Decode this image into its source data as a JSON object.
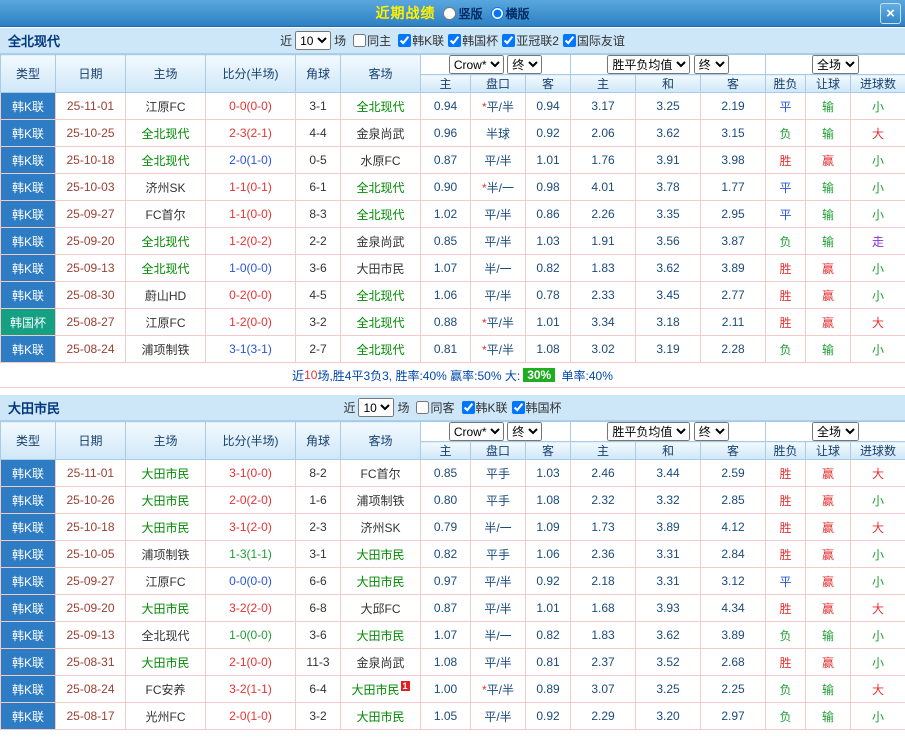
{
  "titlebar": {
    "title": "近期战绩",
    "layout_options": [
      {
        "label": "竖版",
        "checked": false
      },
      {
        "label": "横版",
        "checked": true
      }
    ],
    "close_label": "×"
  },
  "table_header": {
    "main": [
      "类型",
      "日期",
      "主场",
      "比分(半场)",
      "角球",
      "客场"
    ],
    "odds_source": "Crow*",
    "stage_label": "终",
    "avg_label": "胜平负均值",
    "scope_label": "全场",
    "sub": [
      "主",
      "盘口",
      "客",
      "主",
      "和",
      "客",
      "胜负",
      "让球",
      "进球数"
    ]
  },
  "colors": {
    "topbar_blue": "#2e80c4",
    "title_yellow": "#ffef00",
    "strip_blue": "#cde6f8",
    "league_blue": "#2d7cc4",
    "cup_teal": "#14a083",
    "focal_green": "#008a00",
    "date_red": "#9a4033",
    "odds_navy": "#1b4a7a",
    "win_red": "#e53333",
    "draw_blue": "#2b55d5",
    "loss_green": "#1f9e33",
    "push_purple": "#8833cc",
    "highlight_green": "#1fae1f",
    "data_border_pink": "#f2caca",
    "header_border_blue": "#a9cbe6"
  },
  "sections": [
    {
      "team": "全北现代",
      "filters": {
        "near": "近",
        "count": "10",
        "games": "场",
        "same": {
          "label": "同主",
          "checked": false
        },
        "leagues": [
          {
            "label": "韩K联",
            "checked": true
          },
          {
            "label": "韩国杯",
            "checked": true
          },
          {
            "label": "亚冠联2",
            "checked": true
          },
          {
            "label": "国际友谊",
            "checked": true
          }
        ]
      },
      "rows": [
        {
          "league": "韩K联",
          "cup": false,
          "date": "25-11-01",
          "home": "江原FC",
          "home_focal": false,
          "score": "0-0(0-0)",
          "score_color": "red",
          "corners": "3-1",
          "away": "全北现代",
          "away_focal": true,
          "odds_home": "0.94",
          "handicap": "*平/半",
          "odds_away": "0.94",
          "avg_home": "3.17",
          "avg_draw": "3.25",
          "avg_away": "2.19",
          "result": "平",
          "result_color": "blue",
          "handicap_result": "输",
          "handicap_result_color": "green",
          "goals_result": "小",
          "goals_result_color": "green"
        },
        {
          "league": "韩K联",
          "cup": false,
          "date": "25-10-25",
          "home": "全北现代",
          "home_focal": true,
          "score": "2-3(2-1)",
          "score_color": "red",
          "corners": "4-4",
          "away": "金泉尚武",
          "away_focal": false,
          "odds_home": "0.96",
          "handicap": "半球",
          "odds_away": "0.92",
          "avg_home": "2.06",
          "avg_draw": "3.62",
          "avg_away": "3.15",
          "result": "负",
          "result_color": "green",
          "handicap_result": "输",
          "handicap_result_color": "green",
          "goals_result": "大",
          "goals_result_color": "red"
        },
        {
          "league": "韩K联",
          "cup": false,
          "date": "25-10-18",
          "home": "全北现代",
          "home_focal": true,
          "score": "2-0(1-0)",
          "score_color": "blue",
          "corners": "0-5",
          "away": "水原FC",
          "away_focal": false,
          "odds_home": "0.87",
          "handicap": "平/半",
          "odds_away": "1.01",
          "avg_home": "1.76",
          "avg_draw": "3.91",
          "avg_away": "3.98",
          "result": "胜",
          "result_color": "red",
          "handicap_result": "赢",
          "handicap_result_color": "red",
          "goals_result": "小",
          "goals_result_color": "green"
        },
        {
          "league": "韩K联",
          "cup": false,
          "date": "25-10-03",
          "home": "济州SK",
          "home_focal": false,
          "score": "1-1(0-1)",
          "score_color": "red",
          "corners": "6-1",
          "away": "全北现代",
          "away_focal": true,
          "odds_home": "0.90",
          "handicap": "*半/一",
          "odds_away": "0.98",
          "avg_home": "4.01",
          "avg_draw": "3.78",
          "avg_away": "1.77",
          "result": "平",
          "result_color": "blue",
          "handicap_result": "输",
          "handicap_result_color": "green",
          "goals_result": "小",
          "goals_result_color": "green"
        },
        {
          "league": "韩K联",
          "cup": false,
          "date": "25-09-27",
          "home": "FC首尔",
          "home_focal": false,
          "score": "1-1(0-0)",
          "score_color": "red",
          "corners": "8-3",
          "away": "全北现代",
          "away_focal": true,
          "odds_home": "1.02",
          "handicap": "平/半",
          "odds_away": "0.86",
          "avg_home": "2.26",
          "avg_draw": "3.35",
          "avg_away": "2.95",
          "result": "平",
          "result_color": "blue",
          "handicap_result": "输",
          "handicap_result_color": "green",
          "goals_result": "小",
          "goals_result_color": "green"
        },
        {
          "league": "韩K联",
          "cup": false,
          "date": "25-09-20",
          "home": "全北现代",
          "home_focal": true,
          "score": "1-2(0-2)",
          "score_color": "red",
          "corners": "2-2",
          "away": "金泉尚武",
          "away_focal": false,
          "odds_home": "0.85",
          "handicap": "平/半",
          "odds_away": "1.03",
          "avg_home": "1.91",
          "avg_draw": "3.56",
          "avg_away": "3.87",
          "result": "负",
          "result_color": "green",
          "handicap_result": "输",
          "handicap_result_color": "green",
          "goals_result": "走",
          "goals_result_color": "purple"
        },
        {
          "league": "韩K联",
          "cup": false,
          "date": "25-09-13",
          "home": "全北现代",
          "home_focal": true,
          "score": "1-0(0-0)",
          "score_color": "blue",
          "corners": "3-6",
          "away": "大田市民",
          "away_focal": false,
          "odds_home": "1.07",
          "handicap": "半/一",
          "odds_away": "0.82",
          "avg_home": "1.83",
          "avg_draw": "3.62",
          "avg_away": "3.89",
          "result": "胜",
          "result_color": "red",
          "handicap_result": "赢",
          "handicap_result_color": "red",
          "goals_result": "小",
          "goals_result_color": "green"
        },
        {
          "league": "韩K联",
          "cup": false,
          "date": "25-08-30",
          "home": "蔚山HD",
          "home_focal": false,
          "score": "0-2(0-0)",
          "score_color": "red",
          "corners": "4-5",
          "away": "全北现代",
          "away_focal": true,
          "odds_home": "1.06",
          "handicap": "平/半",
          "odds_away": "0.78",
          "avg_home": "2.33",
          "avg_draw": "3.45",
          "avg_away": "2.77",
          "result": "胜",
          "result_color": "red",
          "handicap_result": "赢",
          "handicap_result_color": "red",
          "goals_result": "小",
          "goals_result_color": "green"
        },
        {
          "league": "韩国杯",
          "cup": true,
          "date": "25-08-27",
          "home": "江原FC",
          "home_focal": false,
          "score": "1-2(0-0)",
          "score_color": "red",
          "corners": "3-2",
          "away": "全北现代",
          "away_focal": true,
          "odds_home": "0.88",
          "handicap": "*平/半",
          "odds_away": "1.01",
          "avg_home": "3.34",
          "avg_draw": "3.18",
          "avg_away": "2.11",
          "result": "胜",
          "result_color": "red",
          "handicap_result": "赢",
          "handicap_result_color": "red",
          "goals_result": "大",
          "goals_result_color": "red"
        },
        {
          "league": "韩K联",
          "cup": false,
          "date": "25-08-24",
          "home": "浦项制铁",
          "home_focal": false,
          "score": "3-1(3-1)",
          "score_color": "blue",
          "corners": "2-7",
          "away": "全北现代",
          "away_focal": true,
          "odds_home": "0.81",
          "handicap": "*平/半",
          "odds_away": "1.08",
          "avg_home": "3.02",
          "avg_draw": "3.19",
          "avg_away": "2.28",
          "result": "负",
          "result_color": "green",
          "handicap_result": "输",
          "handicap_result_color": "green",
          "goals_result": "小",
          "goals_result_color": "green"
        }
      ],
      "summary": {
        "pre": "近",
        "count": "10",
        "mid": "场,胜4平3负3, 胜率:40% 赢率:50% 大:",
        "highlight": "30%",
        "tail": " 单率:40%"
      }
    },
    {
      "team": "大田市民",
      "filters": {
        "near": "近",
        "count": "10",
        "games": "场",
        "same": {
          "label": "同客",
          "checked": false
        },
        "leagues": [
          {
            "label": "韩K联",
            "checked": true
          },
          {
            "label": "韩国杯",
            "checked": true
          }
        ]
      },
      "rows": [
        {
          "league": "韩K联",
          "cup": false,
          "date": "25-11-01",
          "home": "大田市民",
          "home_focal": true,
          "score": "3-1(0-0)",
          "score_color": "red",
          "corners": "8-2",
          "away": "FC首尔",
          "away_focal": false,
          "odds_home": "0.85",
          "handicap": "平手",
          "odds_away": "1.03",
          "avg_home": "2.46",
          "avg_draw": "3.44",
          "avg_away": "2.59",
          "result": "胜",
          "result_color": "red",
          "handicap_result": "赢",
          "handicap_result_color": "red",
          "goals_result": "大",
          "goals_result_color": "red"
        },
        {
          "league": "韩K联",
          "cup": false,
          "date": "25-10-26",
          "home": "大田市民",
          "home_focal": true,
          "score": "2-0(2-0)",
          "score_color": "red",
          "corners": "1-6",
          "away": "浦项制铁",
          "away_focal": false,
          "odds_home": "0.80",
          "handicap": "平手",
          "odds_away": "1.08",
          "avg_home": "2.32",
          "avg_draw": "3.32",
          "avg_away": "2.85",
          "result": "胜",
          "result_color": "red",
          "handicap_result": "赢",
          "handicap_result_color": "red",
          "goals_result": "小",
          "goals_result_color": "green"
        },
        {
          "league": "韩K联",
          "cup": false,
          "date": "25-10-18",
          "home": "大田市民",
          "home_focal": true,
          "score": "3-1(2-0)",
          "score_color": "red",
          "corners": "2-3",
          "away": "济州SK",
          "away_focal": false,
          "odds_home": "0.79",
          "handicap": "半/一",
          "odds_away": "1.09",
          "avg_home": "1.73",
          "avg_draw": "3.89",
          "avg_away": "4.12",
          "result": "胜",
          "result_color": "red",
          "handicap_result": "赢",
          "handicap_result_color": "red",
          "goals_result": "大",
          "goals_result_color": "red"
        },
        {
          "league": "韩K联",
          "cup": false,
          "date": "25-10-05",
          "home": "浦项制铁",
          "home_focal": false,
          "score": "1-3(1-1)",
          "score_color": "green",
          "corners": "3-1",
          "away": "大田市民",
          "away_focal": true,
          "odds_home": "0.82",
          "handicap": "平手",
          "odds_away": "1.06",
          "avg_home": "2.36",
          "avg_draw": "3.31",
          "avg_away": "2.84",
          "result": "胜",
          "result_color": "red",
          "handicap_result": "赢",
          "handicap_result_color": "red",
          "goals_result": "小",
          "goals_result_color": "green"
        },
        {
          "league": "韩K联",
          "cup": false,
          "date": "25-09-27",
          "home": "江原FC",
          "home_focal": false,
          "score": "0-0(0-0)",
          "score_color": "blue",
          "corners": "6-6",
          "away": "大田市民",
          "away_focal": true,
          "odds_home": "0.97",
          "handicap": "平/半",
          "odds_away": "0.92",
          "avg_home": "2.18",
          "avg_draw": "3.31",
          "avg_away": "3.12",
          "result": "平",
          "result_color": "blue",
          "handicap_result": "赢",
          "handicap_result_color": "red",
          "goals_result": "小",
          "goals_result_color": "green"
        },
        {
          "league": "韩K联",
          "cup": false,
          "date": "25-09-20",
          "home": "大田市民",
          "home_focal": true,
          "score": "3-2(2-0)",
          "score_color": "red",
          "corners": "6-8",
          "away": "大邱FC",
          "away_focal": false,
          "odds_home": "0.87",
          "handicap": "平/半",
          "odds_away": "1.01",
          "avg_home": "1.68",
          "avg_draw": "3.93",
          "avg_away": "4.34",
          "result": "胜",
          "result_color": "red",
          "handicap_result": "赢",
          "handicap_result_color": "red",
          "goals_result": "大",
          "goals_result_color": "red"
        },
        {
          "league": "韩K联",
          "cup": false,
          "date": "25-09-13",
          "home": "全北现代",
          "home_focal": false,
          "score": "1-0(0-0)",
          "score_color": "green",
          "corners": "3-6",
          "away": "大田市民",
          "away_focal": true,
          "odds_home": "1.07",
          "handicap": "半/一",
          "odds_away": "0.82",
          "avg_home": "1.83",
          "avg_draw": "3.62",
          "avg_away": "3.89",
          "result": "负",
          "result_color": "green",
          "handicap_result": "输",
          "handicap_result_color": "green",
          "goals_result": "小",
          "goals_result_color": "green"
        },
        {
          "league": "韩K联",
          "cup": false,
          "date": "25-08-31",
          "home": "大田市民",
          "home_focal": true,
          "score": "2-1(0-0)",
          "score_color": "red",
          "corners": "11-3",
          "away": "金泉尚武",
          "away_focal": false,
          "odds_home": "1.08",
          "handicap": "平/半",
          "odds_away": "0.81",
          "avg_home": "2.37",
          "avg_draw": "3.52",
          "avg_away": "2.68",
          "result": "胜",
          "result_color": "red",
          "handicap_result": "赢",
          "handicap_result_color": "red",
          "goals_result": "小",
          "goals_result_color": "green"
        },
        {
          "league": "韩K联",
          "cup": false,
          "date": "25-08-24",
          "home": "FC安养",
          "home_focal": false,
          "score": "3-2(1-1)",
          "score_color": "red",
          "corners": "6-4",
          "away": "大田市民",
          "away_focal": true,
          "badge": "1",
          "odds_home": "1.00",
          "handicap": "*平/半",
          "odds_away": "0.89",
          "avg_home": "3.07",
          "avg_draw": "3.25",
          "avg_away": "2.25",
          "result": "负",
          "result_color": "green",
          "handicap_result": "输",
          "handicap_result_color": "green",
          "goals_result": "大",
          "goals_result_color": "red"
        },
        {
          "league": "韩K联",
          "cup": false,
          "date": "25-08-17",
          "home": "光州FC",
          "home_focal": false,
          "score": "2-0(1-0)",
          "score_color": "red",
          "corners": "3-2",
          "away": "大田市民",
          "away_focal": true,
          "odds_home": "1.05",
          "handicap": "平/半",
          "odds_away": "0.92",
          "avg_home": "2.29",
          "avg_draw": "3.20",
          "avg_away": "2.97",
          "result": "负",
          "result_color": "green",
          "handicap_result": "输",
          "handicap_result_color": "green",
          "goals_result": "小",
          "goals_result_color": "green"
        }
      ]
    }
  ]
}
